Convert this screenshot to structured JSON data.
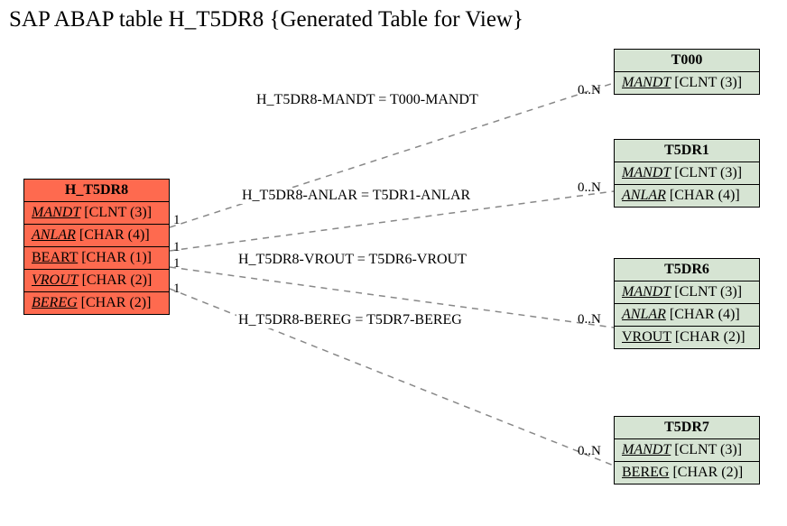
{
  "title": "SAP ABAP table H_T5DR8 {Generated Table for View}",
  "left_entity": {
    "name": "H_T5DR8",
    "fields": [
      {
        "name": "MANDT",
        "type": "[CLNT (3)]",
        "italic": true
      },
      {
        "name": "ANLAR",
        "type": "[CHAR (4)]",
        "italic": true
      },
      {
        "name": "BEART",
        "type": "[CHAR (1)]",
        "italic": false
      },
      {
        "name": "VROUT",
        "type": "[CHAR (2)]",
        "italic": true
      },
      {
        "name": "BEREG",
        "type": "[CHAR (2)]",
        "italic": true
      }
    ]
  },
  "right_entities": [
    {
      "name": "T000",
      "fields": [
        {
          "name": "MANDT",
          "type": "[CLNT (3)]",
          "italic": true
        }
      ]
    },
    {
      "name": "T5DR1",
      "fields": [
        {
          "name": "MANDT",
          "type": "[CLNT (3)]",
          "italic": true
        },
        {
          "name": "ANLAR",
          "type": "[CHAR (4)]",
          "italic": true
        }
      ]
    },
    {
      "name": "T5DR6",
      "fields": [
        {
          "name": "MANDT",
          "type": "[CLNT (3)]",
          "italic": true
        },
        {
          "name": "ANLAR",
          "type": "[CHAR (4)]",
          "italic": true
        },
        {
          "name": "VROUT",
          "type": "[CHAR (2)]",
          "italic": false
        }
      ]
    },
    {
      "name": "T5DR7",
      "fields": [
        {
          "name": "MANDT",
          "type": "[CLNT (3)]",
          "italic": true
        },
        {
          "name": "BEREG",
          "type": "[CHAR (2)]",
          "italic": false
        }
      ]
    }
  ],
  "relationships": [
    {
      "label": "H_T5DR8-MANDT = T000-MANDT",
      "left_card": "1",
      "right_card": "0..N"
    },
    {
      "label": "H_T5DR8-ANLAR = T5DR1-ANLAR",
      "left_card": "1",
      "right_card": "0..N"
    },
    {
      "label": "H_T5DR8-VROUT = T5DR6-VROUT",
      "left_card": "1",
      "right_card": "0..N"
    },
    {
      "label": "H_T5DR8-BEREG = T5DR7-BEREG",
      "left_card": "1",
      "right_card": "0..N"
    }
  ]
}
